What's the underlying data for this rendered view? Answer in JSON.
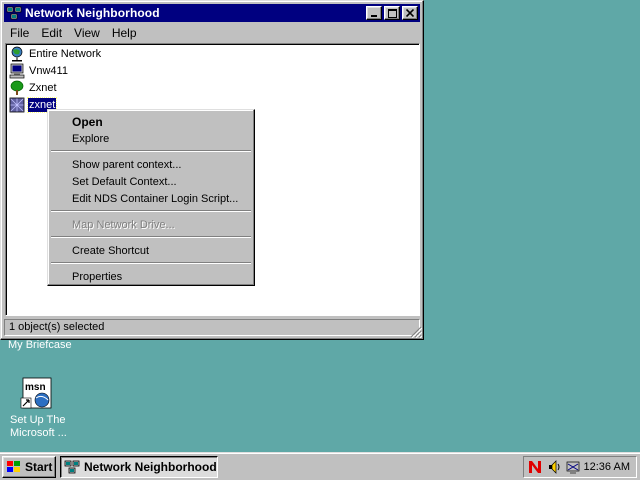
{
  "window": {
    "title": "Network Neighborhood",
    "buttons": {
      "minimize": "_",
      "maximize": "□",
      "close": "✕"
    },
    "menu": [
      "File",
      "Edit",
      "View",
      "Help"
    ],
    "items": [
      {
        "label": "Entire Network",
        "icon": "globe-network-icon"
      },
      {
        "label": "Vnw411",
        "icon": "computer-icon"
      },
      {
        "label": "Zxnet",
        "icon": "tree-icon"
      },
      {
        "label": "zxnet",
        "icon": "server-icon",
        "selected": true
      }
    ],
    "status": "1 object(s) selected"
  },
  "context_menu": {
    "items": [
      {
        "label": "Open",
        "default": true
      },
      {
        "label": "Explore"
      },
      {
        "separator": true
      },
      {
        "label": "Show parent context..."
      },
      {
        "label": "Set Default Context..."
      },
      {
        "label": "Edit NDS Container Login Script..."
      },
      {
        "separator": true
      },
      {
        "label": "Map Network Drive...",
        "disabled": true
      },
      {
        "separator": true
      },
      {
        "label": "Create Shortcut"
      },
      {
        "separator": true
      },
      {
        "label": "Properties"
      }
    ]
  },
  "desktop": {
    "briefcase_label": "My Briefcase",
    "msn_label_line1": "Set Up The",
    "msn_label_line2": "Microsoft ..."
  },
  "taskbar": {
    "start_label": "Start",
    "task_label": "Network Neighborhood",
    "clock": "12:36 AM"
  },
  "colors": {
    "desktop": "#5fa8a7",
    "titlebar": "#000080",
    "face": "#c0c0c0"
  }
}
